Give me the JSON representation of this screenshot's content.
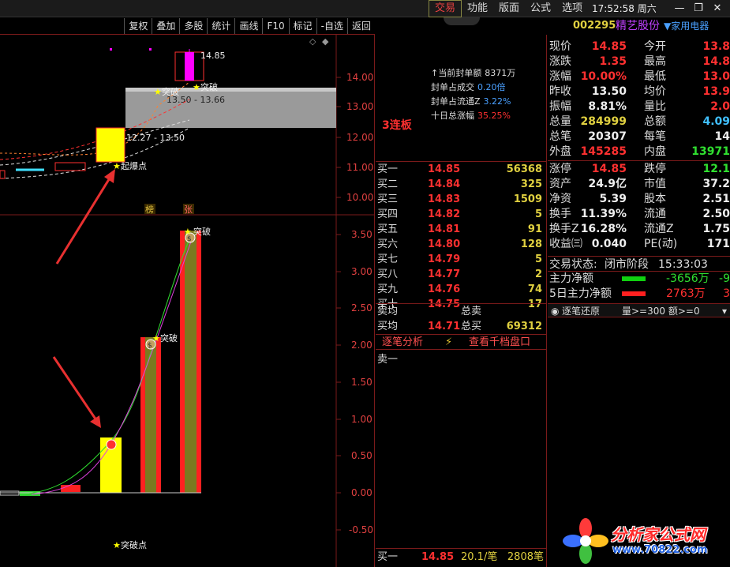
{
  "menu": {
    "items": [
      "交易",
      "功能",
      "版面",
      "公式",
      "选项"
    ],
    "active": "交易"
  },
  "clock": "17:52:58 周六",
  "window": {
    "minimize": "—",
    "restore": "❐",
    "close": "✕"
  },
  "toolbar": {
    "buttons": [
      "复权",
      "叠加",
      "多股",
      "统计",
      "画线",
      "F10",
      "标记",
      "-自选",
      "返回"
    ]
  },
  "chart": {
    "upper_axis": [
      "14.00",
      "13.00",
      "12.00",
      "11.00",
      "10.00"
    ],
    "lower_axis": [
      "3.50",
      "3.00",
      "2.50",
      "2.00",
      "1.50",
      "1.00",
      "0.50",
      "0.00",
      "-0.50"
    ],
    "labels": {
      "high": "14.85",
      "breakout_upper": "突破",
      "breakout_upper2": "突破",
      "zone": "13.50 - 13.66",
      "zone2": "12.27 - 13.50",
      "explode": "起爆点",
      "tag1": "榜",
      "tag2": "张",
      "top_label": "突破",
      "mid_label": "突破",
      "bottom_label": "突破点"
    },
    "colors": {
      "up": "#ff2020",
      "yellow": "#ffff00",
      "olive": "#7a7a20",
      "magenta": "#ff00ff",
      "cyan": "#40e0ff",
      "green": "#30d030",
      "zone": "#9a9a9a"
    }
  },
  "seal": {
    "lianban": "3连板",
    "rows": [
      {
        "label": "↑当前封单额",
        "value": "8371万",
        "color": "white"
      },
      {
        "label": "封单占成交",
        "value": "0.20倍",
        "color": "blue"
      },
      {
        "label": "封单占流通Z",
        "value": "3.22%",
        "color": "blue"
      },
      {
        "label": "十日总涨幅",
        "value": "35.25%",
        "color": "red"
      }
    ]
  },
  "orderbook": [
    {
      "label": "买一",
      "price": "14.85",
      "vol": "56368"
    },
    {
      "label": "买二",
      "price": "14.84",
      "vol": "325"
    },
    {
      "label": "买三",
      "price": "14.83",
      "vol": "1509"
    },
    {
      "label": "买四",
      "price": "14.82",
      "vol": "5"
    },
    {
      "label": "买五",
      "price": "14.81",
      "vol": "91"
    },
    {
      "label": "买六",
      "price": "14.80",
      "vol": "128"
    },
    {
      "label": "买七",
      "price": "14.79",
      "vol": "5"
    },
    {
      "label": "买八",
      "price": "14.77",
      "vol": "2"
    },
    {
      "label": "买九",
      "price": "14.76",
      "vol": "74"
    },
    {
      "label": "买十",
      "price": "14.75",
      "vol": "17"
    }
  ],
  "avg": [
    {
      "label": "卖均",
      "price": "",
      "label2": "总卖",
      "val": ""
    },
    {
      "label": "买均",
      "price": "14.71",
      "label2": "总买",
      "val": "69312"
    }
  ],
  "analysis_tabs": {
    "tab1": "逐笔分析",
    "tab2": "查看千档盘口"
  },
  "tick_label": "卖一",
  "tick_bottom": {
    "label": "买一",
    "price": "14.85",
    "avg": "20.1/笔",
    "count": "2808笔"
  },
  "stock": {
    "code": "002295",
    "name": "精艺股份",
    "sector": "▼家用电器"
  },
  "quote": [
    {
      "l1": "现价",
      "v1": "14.85",
      "c1": "red",
      "l2": "今开",
      "v2": "13.8",
      "c2": "red"
    },
    {
      "l1": "涨跌",
      "v1": "1.35",
      "c1": "red",
      "l2": "最高",
      "v2": "14.8",
      "c2": "red"
    },
    {
      "l1": "涨幅",
      "v1": "10.00%",
      "c1": "red",
      "l2": "最低",
      "v2": "13.0",
      "c2": "red"
    },
    {
      "l1": "昨收",
      "v1": "13.50",
      "c1": "white",
      "l2": "均价",
      "v2": "13.9",
      "c2": "red"
    },
    {
      "l1": "振幅",
      "v1": "8.81%",
      "c1": "white",
      "l2": "量比",
      "v2": "2.0",
      "c2": "red"
    },
    {
      "l1": "总量",
      "v1": "284999",
      "c1": "yellow",
      "l2": "总额",
      "v2": "4.09",
      "c2": "cyan"
    },
    {
      "l1": "总笔",
      "v1": "20307",
      "c1": "white",
      "l2": "每笔",
      "v2": "14",
      "c2": "white"
    },
    {
      "l1": "外盘",
      "v1": "145285",
      "c1": "red",
      "l2": "内盘",
      "v2": "13971",
      "c2": "green"
    }
  ],
  "quote2": [
    {
      "l1": "涨停",
      "v1": "14.85",
      "c1": "red",
      "l2": "跌停",
      "v2": "12.1",
      "c2": "green"
    },
    {
      "l1": "资产",
      "v1": "24.9亿",
      "c1": "white",
      "l2": "市值",
      "v2": "37.2",
      "c2": "white"
    },
    {
      "l1": "净资",
      "v1": "5.39",
      "c1": "white",
      "l2": "股本",
      "v2": "2.51",
      "c2": "white"
    },
    {
      "l1": "换手",
      "v1": "11.39%",
      "c1": "white",
      "l2": "流通",
      "v2": "2.50",
      "c2": "white"
    },
    {
      "l1": "换手Z",
      "v1": "16.28%",
      "c1": "white",
      "l2": "流通Z",
      "v2": "1.75",
      "c2": "white"
    },
    {
      "l1": "收益㈢",
      "v1": "0.040",
      "c1": "white",
      "l2": "PE(动)",
      "v2": "171",
      "c2": "white"
    }
  ],
  "trade_status": {
    "label": "交易状态:",
    "state": "闭市阶段",
    "time": "15:33:03"
  },
  "flow": [
    {
      "label": "主力净额",
      "val": "-3656万",
      "val2": "-9",
      "bar": "#10d010",
      "vc": "green"
    },
    {
      "label": "5日主力净额",
      "val": "2763万",
      "val2": "3",
      "bar": "#ff2020",
      "vc": "red"
    }
  ],
  "tick_filter": {
    "label": "逐笔还原",
    "filter": "量>=300 额>=0"
  },
  "watermark": {
    "text": "分析家公式网",
    "url": "www.70822.com"
  }
}
